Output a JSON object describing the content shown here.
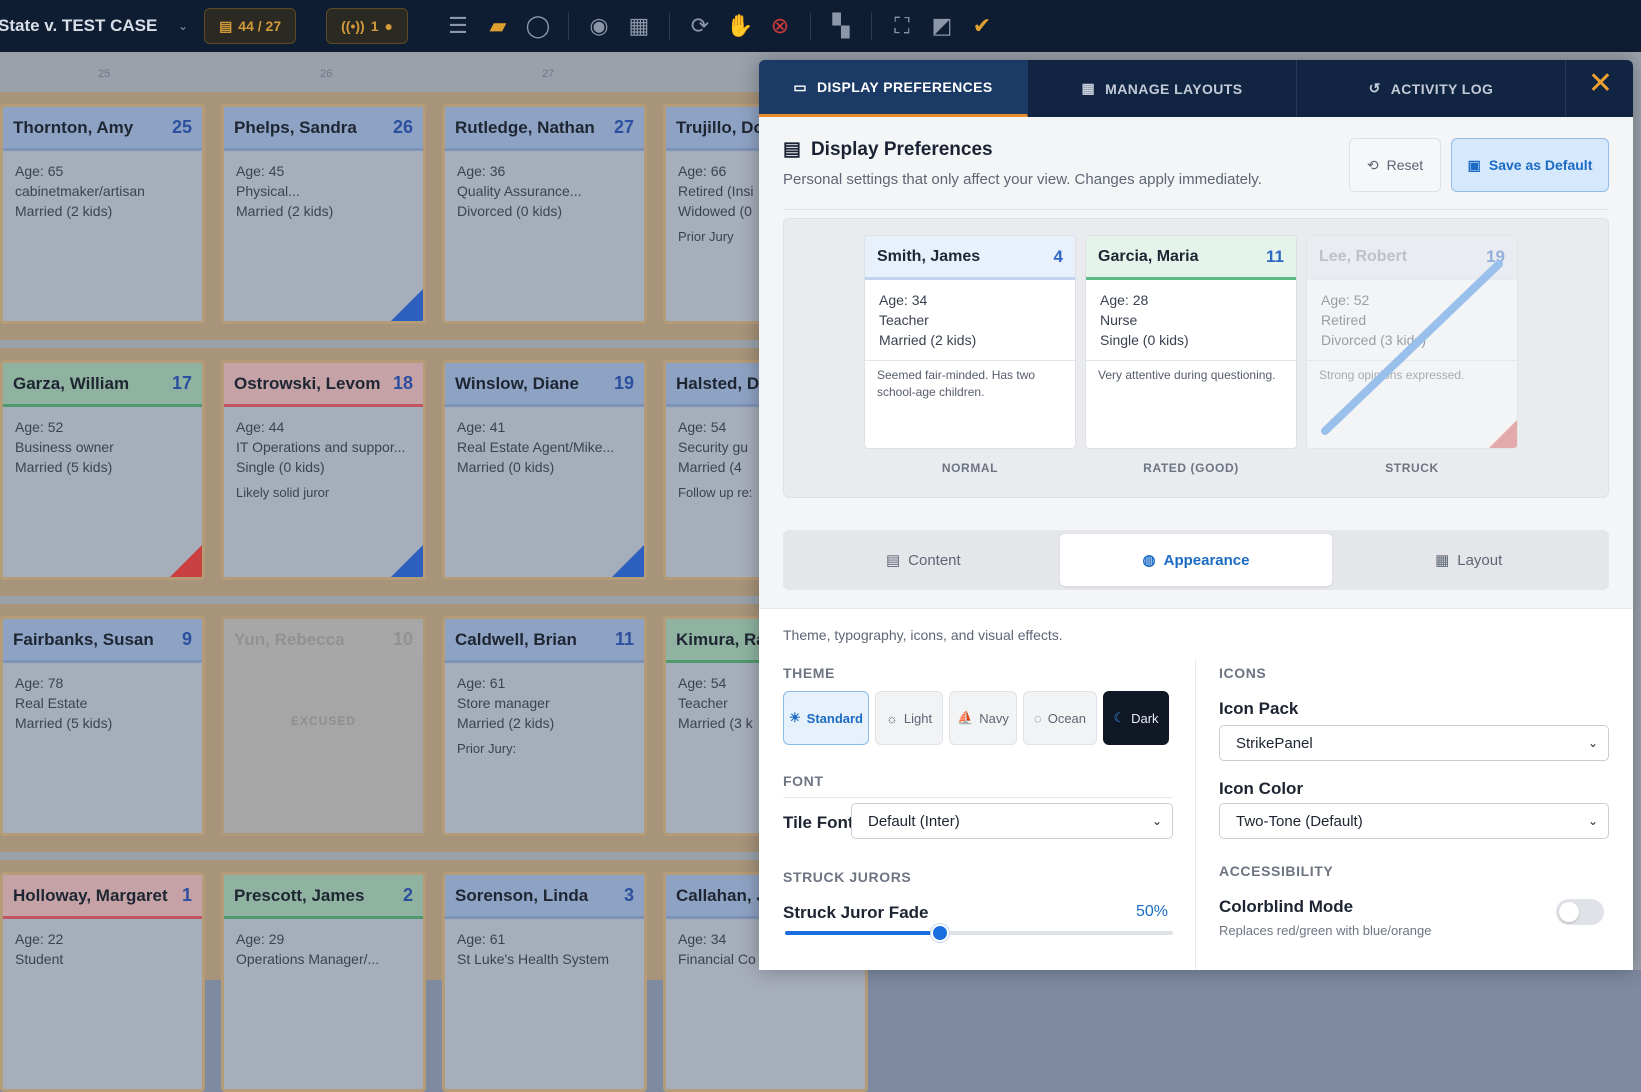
{
  "topbar": {
    "case_title": "State v. TEST CASE",
    "juror_count": "44 / 27",
    "live_count": "1"
  },
  "board": {
    "ruler": [
      "25",
      "26",
      "27"
    ],
    "tiles": [
      {
        "name": "Thornton, Amy",
        "num": "25",
        "age": "Age: 65",
        "occupation": "cabinetmaker/artisan",
        "family": "Married (2 kids)",
        "note": ""
      },
      {
        "name": "Phelps, Sandra",
        "num": "26",
        "age": "Age: 45",
        "occupation": "Physical...",
        "family": "Married (2 kids)",
        "note": ""
      },
      {
        "name": "Rutledge, Nathan",
        "num": "27",
        "age": "Age: 36",
        "occupation": "Quality Assurance...",
        "family": "Divorced (0 kids)",
        "note": ""
      },
      {
        "name": "Trujillo, Do",
        "num": "",
        "age": "Age: 66",
        "occupation": "Retired (Insi",
        "family": "Widowed (0",
        "note": "Prior Jury"
      },
      {
        "name": "Garza, William",
        "num": "17",
        "age": "Age: 52",
        "occupation": "Business owner",
        "family": "Married (5 kids)",
        "note": ""
      },
      {
        "name": "Ostrowski, Levom",
        "num": "18",
        "age": "Age: 44",
        "occupation": "IT Operations and suppor...",
        "family": "Single (0 kids)",
        "note": "Likely solid juror"
      },
      {
        "name": "Winslow, Diane",
        "num": "19",
        "age": "Age: 41",
        "occupation": "Real Estate Agent/Mike...",
        "family": "Married (0 kids)",
        "note": ""
      },
      {
        "name": "Halsted, D",
        "num": "",
        "age": "Age: 54",
        "occupation": "Security gu",
        "family": "Married (4",
        "note": "Follow up re:"
      },
      {
        "name": "Fairbanks, Susan",
        "num": "9",
        "age": "Age: 78",
        "occupation": "Real Estate",
        "family": "Married (5 kids)",
        "note": ""
      },
      {
        "name": "Yun, Rebecca",
        "num": "10",
        "age": "",
        "occupation": "",
        "family": "",
        "note": "EXCUSED"
      },
      {
        "name": "Caldwell, Brian",
        "num": "11",
        "age": "Age: 61",
        "occupation": "Store manager",
        "family": "Married (2 kids)",
        "note": "Prior Jury:"
      },
      {
        "name": "Kimura, Ra",
        "num": "",
        "age": "Age: 54",
        "occupation": "Teacher",
        "family": "Married (3 k",
        "note": ""
      },
      {
        "name": "Holloway, Margaret",
        "num": "1",
        "age": "Age: 22",
        "occupation": "Student",
        "family": "",
        "note": ""
      },
      {
        "name": "Prescott, James",
        "num": "2",
        "age": "Age: 29",
        "occupation": "Operations Manager/...",
        "family": "",
        "note": ""
      },
      {
        "name": "Sorenson, Linda",
        "num": "3",
        "age": "Age: 61",
        "occupation": "St Luke's Health System",
        "family": "",
        "note": ""
      },
      {
        "name": "Callahan, J",
        "num": "",
        "age": "Age: 34",
        "occupation": "Financial Co",
        "family": "",
        "note": ""
      }
    ]
  },
  "modal": {
    "tabs": [
      "DISPLAY PREFERENCES",
      "MANAGE LAYOUTS",
      "ACTIVITY LOG"
    ],
    "close": "✕",
    "title": "Display Preferences",
    "subtitle": "Personal settings that only affect your view. Changes apply immediately.",
    "reset": "Reset",
    "save": "Save as Default",
    "preview": [
      {
        "name": "Smith, James",
        "num": "4",
        "age": "Age: 34",
        "occupation": "Teacher",
        "family": "Married (2 kids)",
        "note": "Seemed fair-minded. Has two school-age children.",
        "label": "NORMAL"
      },
      {
        "name": "Garcia, Maria",
        "num": "11",
        "age": "Age: 28",
        "occupation": "Nurse",
        "family": "Single (0 kids)",
        "note": "Very attentive during questioning.",
        "label": "RATED (GOOD)"
      },
      {
        "name": "Lee, Robert",
        "num": "19",
        "age": "Age: 52",
        "occupation": "Retired",
        "family": "Divorced (3 kids)",
        "note": "Strong opinions expressed.",
        "label": "STRUCK"
      }
    ],
    "subtabs": [
      "Content",
      "Appearance",
      "Layout"
    ],
    "description": "Theme, typography, icons, and visual effects.",
    "theme_label": "THEME",
    "themes": [
      "Standard",
      "Light",
      "Navy",
      "Ocean",
      "Dark"
    ],
    "font_label": "FONT",
    "tile_font_label": "Tile Font",
    "tile_font_value": "Default (Inter)",
    "struck_label": "STRUCK JURORS",
    "fade_label": "Struck Juror Fade",
    "fade_value": "50%",
    "fade_fraction": 0.4,
    "icons_label": "ICONS",
    "icon_pack_label": "Icon Pack",
    "icon_pack_value": "StrikePanel",
    "icon_color_label": "Icon Color",
    "icon_color_value": "Two-Tone (Default)",
    "accessibility_label": "ACCESSIBILITY",
    "colorblind_label": "Colorblind Mode",
    "colorblind_sub": "Replaces red/green with blue/orange",
    "colorblind_on": false
  }
}
